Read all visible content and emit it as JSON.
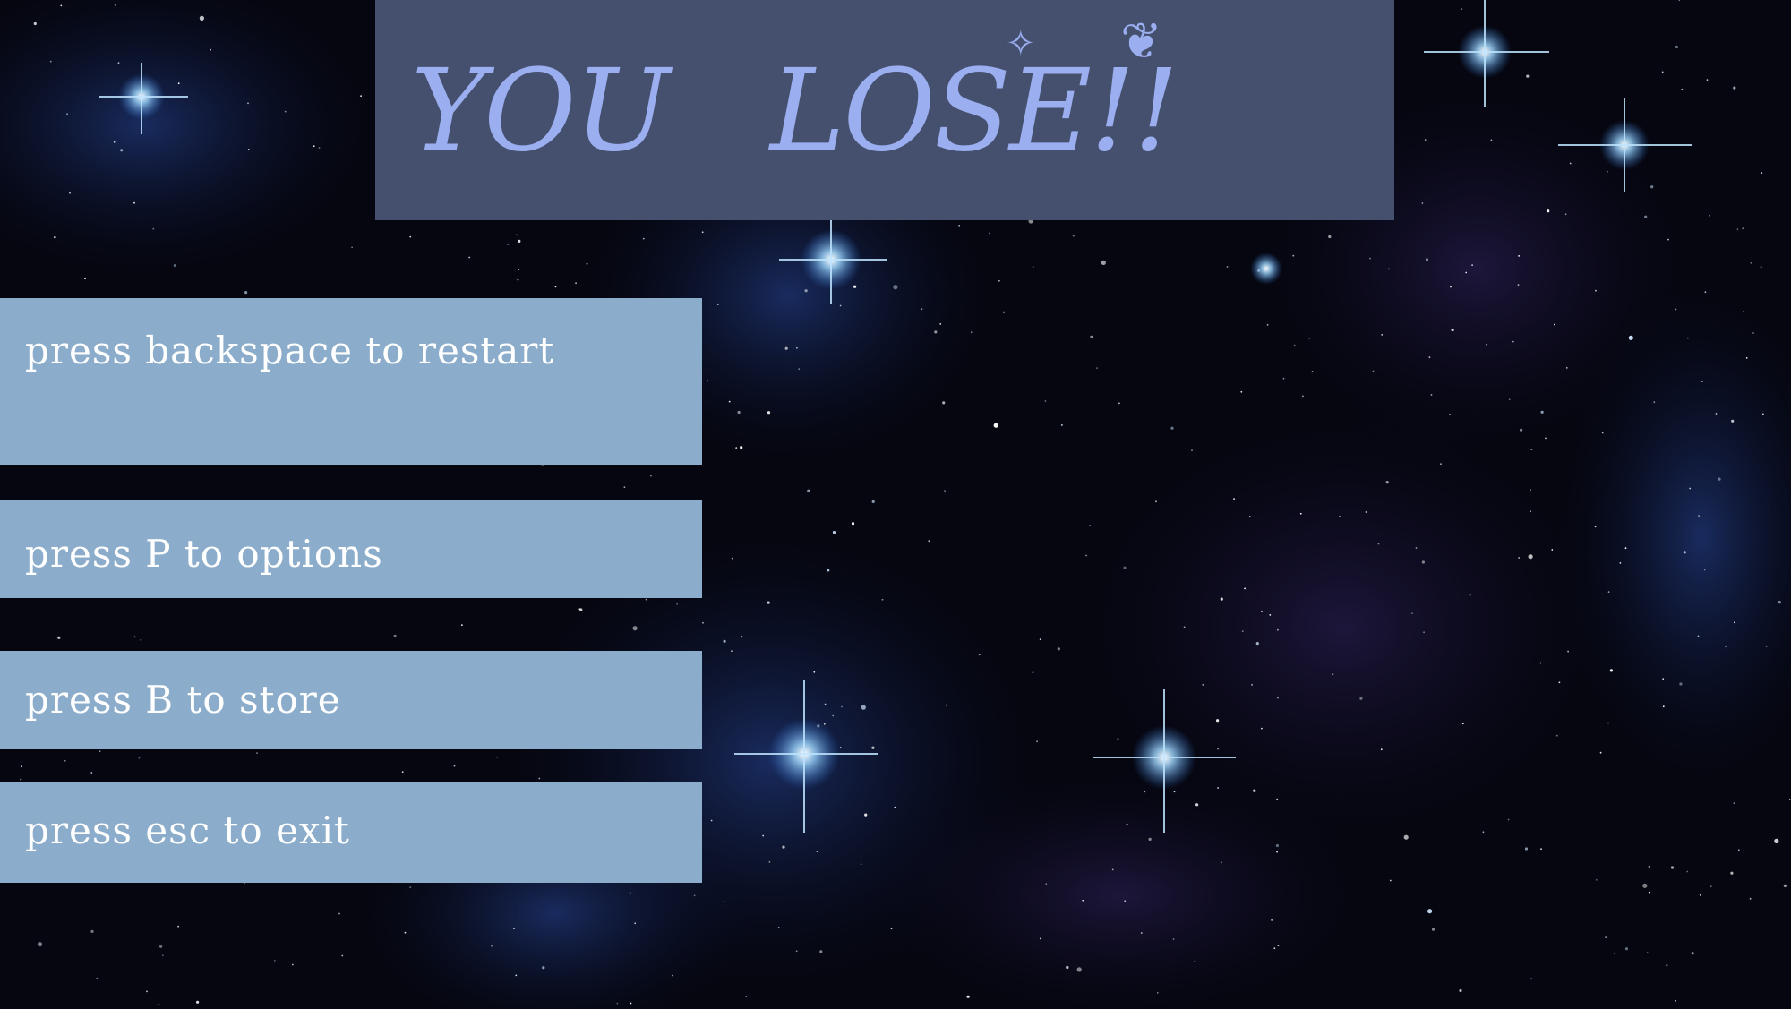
{
  "screen": {
    "title": "YOU   LOSE!!"
  },
  "menu": {
    "items": [
      {
        "label": "press backspace to restart"
      },
      {
        "label": "press P to options"
      },
      {
        "label": "press B to store"
      },
      {
        "label": "press esc to exit"
      }
    ]
  },
  "colors": {
    "title_panel": "#45506e",
    "title_text": "#9aaef0",
    "menu_panel": "#8badcb",
    "menu_text": "#ffffff",
    "space_background": "#05060f"
  }
}
